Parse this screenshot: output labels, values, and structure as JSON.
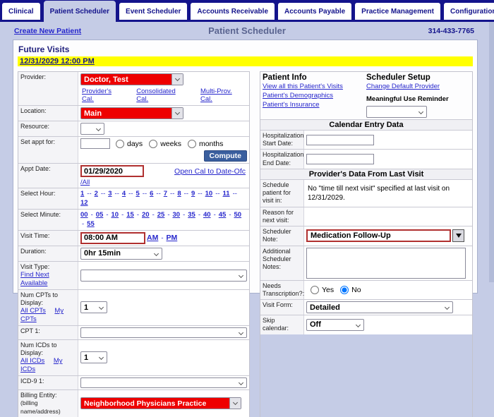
{
  "colors": {
    "navy": "#14148c",
    "lavender": "#c5cce6",
    "highlight_red": "#ee0000",
    "alert_border_red": "#b03030",
    "link_blue": "#2626cc",
    "yellow": "#ffff00",
    "compute_blue": "#3a5f9e",
    "title_gray_blue": "#5a6490"
  },
  "tabs": [
    {
      "label": "Clinical",
      "active": false
    },
    {
      "label": "Patient Scheduler",
      "active": true
    },
    {
      "label": "Event Scheduler",
      "active": false
    },
    {
      "label": "Accounts Receivable",
      "active": false
    },
    {
      "label": "Accounts Payable",
      "active": false
    },
    {
      "label": "Practice Management",
      "active": false
    },
    {
      "label": "Configuration",
      "active": false
    }
  ],
  "header": {
    "create_link": "Create New Patient",
    "title": "Patient Scheduler",
    "phone": "314-433-7765"
  },
  "page": {
    "section_title": "Future Visits",
    "visit_date_link": "12/31/2029 12:00 PM"
  },
  "left_form": {
    "provider_label": "Provider:",
    "provider_value": "Doctor, Test",
    "provider_cal_link": "Provider's Cal.",
    "consolidated_cal_link": "Consolidated Cal.",
    "multi_prov_cal_link": "Multi-Prov. Cal.",
    "location_label": "Location:",
    "location_value": "Main",
    "resource_label": "Resource:",
    "set_appt_label": "Set appt for:",
    "radio_days": "days",
    "radio_weeks": "weeks",
    "radio_months": "months",
    "compute_button": "Compute",
    "appt_date_label": "Appt Date:",
    "appt_date_value": "01/29/2020",
    "open_cal_link": "Open Cal to Date-Ofc",
    "all_link": "/All",
    "select_hour_label": "Select Hour:",
    "hours": [
      "1",
      "2",
      "3",
      "4",
      "5",
      "6",
      "7",
      "8",
      "9",
      "10",
      "11",
      "12"
    ],
    "hour_sep": "--",
    "select_minute_label": "Select Minute:",
    "minutes": [
      "00",
      "05",
      "10",
      "15",
      "20",
      "25",
      "30",
      "35",
      "40",
      "45",
      "50",
      "55"
    ],
    "minute_sep": "-",
    "visit_time_label": "Visit Time:",
    "visit_time_value": "08:00 AM",
    "am_link": "AM",
    "ampm_sep": "-",
    "pm_link": "PM",
    "duration_label": "Duration:",
    "duration_value": "0hr 15min",
    "visit_type_label": "Visit Type:",
    "find_next_link": "Find Next Available",
    "num_cpts_label": "Num CPTs to Display:",
    "all_cpts_link": "All CPTs",
    "my_cpts_link": "My CPTs",
    "num_cpts_value": "1",
    "cpt1_label": "CPT 1:",
    "num_icds_label": "Num ICDs to Display:",
    "all_icds_link": "All ICDs",
    "my_icds_link": "My ICDs",
    "num_icds_value": "1",
    "icd9_label": "ICD-9 1:",
    "billing_label": "Billing Entity:",
    "billing_sublabel": "(billing name/address)",
    "billing_value": "Neighborhood Physicians Practice"
  },
  "right_panel": {
    "patient_info_title": "Patient Info",
    "patient_visits_link": "View all this Patient's Visits",
    "patient_demographics_link": "Patient's Demographics",
    "patient_insurance_link": "Patient's Insurance",
    "scheduler_setup_title": "Scheduler Setup",
    "change_provider_link": "Change Default Provider",
    "meaningful_use_label": "Meaningful Use Reminder",
    "calendar_entry_title": "Calendar Entry Data",
    "hosp_start_label": "Hospitalization Start Date:",
    "hosp_end_label": "Hospitalization End Date:",
    "provider_data_title": "Provider's Data From Last Visit",
    "schedule_in_label": "Schedule patient for visit in:",
    "schedule_in_value": "No \"time till next visit\" specified at last visit on 12/31/2029.",
    "reason_label": "Reason for next visit:",
    "scheduler_note_label": "Scheduler Note:",
    "scheduler_note_value": "Medication Follow-Up",
    "add_notes_label": "Additional Scheduler Notes:",
    "transcription_label": "Needs Transcription?:",
    "yes_label": "Yes",
    "no_label": "No",
    "transcription_value": "No",
    "visit_form_label": "Visit Form:",
    "visit_form_value": "Detailed",
    "skip_cal_label": "Skip calendar:",
    "skip_cal_value": "Off"
  }
}
